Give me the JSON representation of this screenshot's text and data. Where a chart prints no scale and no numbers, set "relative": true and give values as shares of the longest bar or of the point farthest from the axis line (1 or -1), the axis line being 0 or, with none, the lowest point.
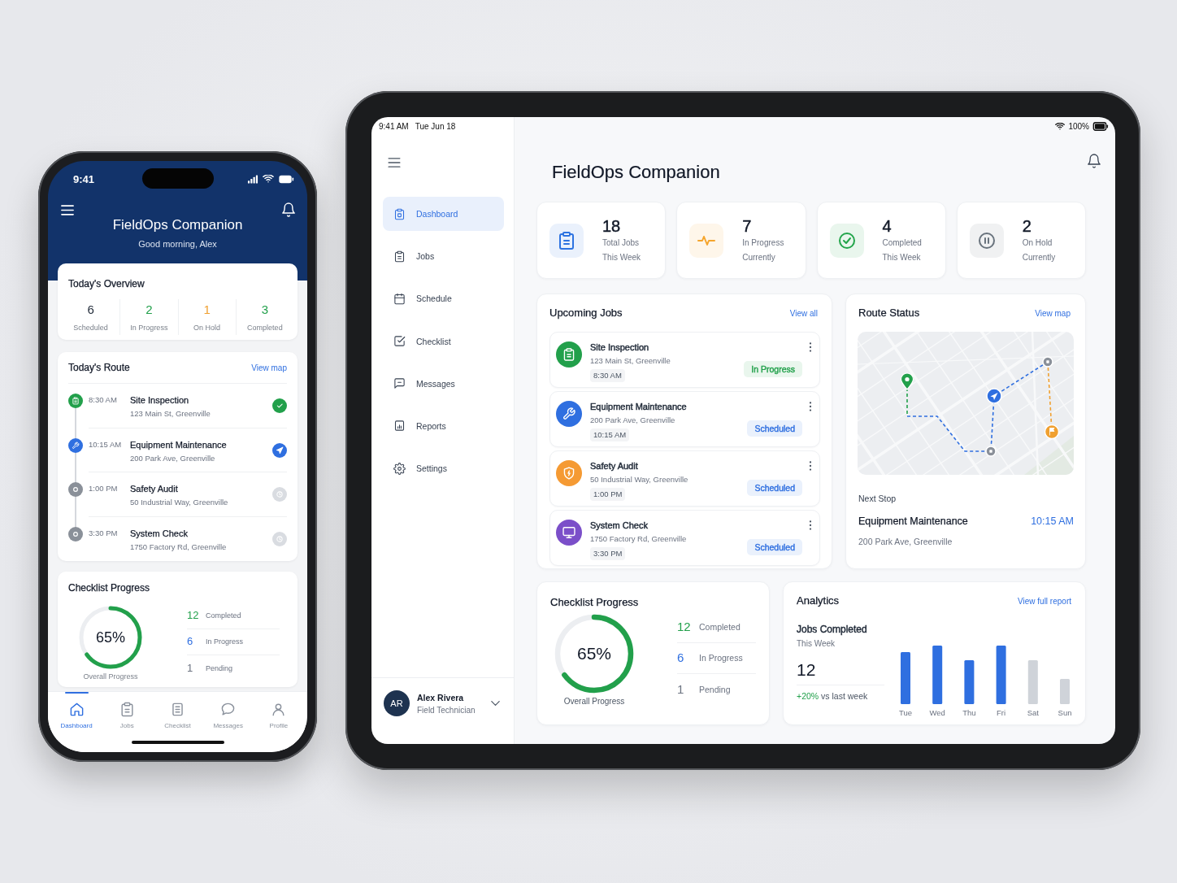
{
  "phone": {
    "status_bar": {
      "time": "9:41"
    },
    "header": {
      "title": "FieldOps Companion",
      "greeting": "Good morning, Alex"
    },
    "overview": {
      "title": "Today's Overview",
      "stats": [
        {
          "value": "6",
          "label": "Scheduled",
          "color": "#1f2937"
        },
        {
          "value": "2",
          "label": "In Progress",
          "color": "#22a04b"
        },
        {
          "value": "1",
          "label": "On Hold",
          "color": "#f0a030"
        },
        {
          "value": "3",
          "label": "Completed",
          "color": "#22a04b"
        }
      ]
    },
    "route": {
      "title": "Today's Route",
      "link": "View map",
      "stops": [
        {
          "time": "8:30 AM",
          "title": "Site Inspection",
          "address": "123 Main St, Greenville",
          "kind": "done"
        },
        {
          "time": "10:15 AM",
          "title": "Equipment Maintenance",
          "address": "200 Park Ave, Greenville",
          "kind": "current"
        },
        {
          "time": "1:00 PM",
          "title": "Safety Audit",
          "address": "50 Industrial Way, Greenville",
          "kind": "upcoming"
        },
        {
          "time": "3:30 PM",
          "title": "System Check",
          "address": "1750 Factory Rd, Greenville",
          "kind": "upcoming"
        }
      ]
    },
    "checklist": {
      "title": "Checklist Progress",
      "level": 0.65,
      "percent": "65%",
      "caption": "Overall Progress",
      "items": [
        {
          "count": "12",
          "label": "Completed",
          "color": "#22a04b"
        },
        {
          "count": "6",
          "label": "In Progress",
          "color": "#2f6fe0"
        },
        {
          "count": "1",
          "label": "Pending",
          "color": "#6b7280"
        }
      ]
    },
    "tab_bar": [
      {
        "label": "Dashboard",
        "selected": true
      },
      {
        "label": "Jobs",
        "selected": false
      },
      {
        "label": "Checklist",
        "selected": false
      },
      {
        "label": "Messages",
        "selected": false
      },
      {
        "label": "Profile",
        "selected": false
      }
    ]
  },
  "tablet": {
    "status_bar": {
      "time": "9:41 AM",
      "date": "Tue Jun 18",
      "battery": "100%"
    },
    "sidebar": {
      "items": [
        {
          "label": "Dashboard",
          "selected": true
        },
        {
          "label": "Jobs",
          "selected": false
        },
        {
          "label": "Schedule",
          "selected": false
        },
        {
          "label": "Checklist",
          "selected": false
        },
        {
          "label": "Messages",
          "selected": false
        },
        {
          "label": "Reports",
          "selected": false
        },
        {
          "label": "Settings",
          "selected": false
        }
      ],
      "user": {
        "initials": "AR",
        "name": "Alex Rivera",
        "role": "Field Technician"
      }
    },
    "header": {
      "title": "FieldOps Companion"
    },
    "stats": [
      {
        "value": "18",
        "label": "Total Jobs",
        "period": "This Week",
        "color": "#eaf1fc"
      },
      {
        "value": "7",
        "label": "In Progress",
        "period": "Currently",
        "color": "#fef6ea"
      },
      {
        "value": "4",
        "label": "Completed",
        "period": "This Week",
        "color": "#e9f6ed"
      },
      {
        "value": "2",
        "label": "On Hold",
        "period": "Currently",
        "color": "#f0f1f2"
      }
    ],
    "upcoming_jobs": {
      "title": "Upcoming Jobs",
      "link": "View all",
      "jobs": [
        {
          "title": "Site Inspection",
          "address": "123 Main St, Greenville",
          "time": "8:30 AM",
          "color": "#22a04b",
          "badge": {
            "label": "In Progress",
            "color": "#22a04b"
          }
        },
        {
          "title": "Equipment Maintenance",
          "address": "200 Park Ave, Greenville",
          "time": "10:15 AM",
          "color": "#2f6fe0",
          "badge": {
            "label": "Scheduled",
            "color": "#2f6fe0"
          }
        },
        {
          "title": "Safety Audit",
          "address": "50 Industrial Way, Greenville",
          "time": "1:00 PM",
          "color": "#f59a33",
          "badge": {
            "label": "Scheduled",
            "color": "#2f6fe0"
          }
        },
        {
          "title": "System Check",
          "address": "1750 Factory Rd, Greenville",
          "time": "3:30 PM",
          "color": "#7b4fc9",
          "badge": {
            "label": "Scheduled",
            "color": "#2f6fe0"
          }
        }
      ]
    },
    "route_status": {
      "title": "Route Status",
      "link": "View map",
      "next_stop": {
        "label": "Next Stop",
        "title": "Equipment Maintenance",
        "time": "10:15 AM",
        "address": "200 Park Ave, Greenville"
      }
    },
    "checklist": {
      "title": "Checklist Progress",
      "level": 0.65,
      "percent": "65%",
      "caption": "Overall Progress",
      "items": [
        {
          "count": "12",
          "label": "Completed",
          "color": "#22a04b"
        },
        {
          "count": "6",
          "label": "In Progress",
          "color": "#2f6fe0"
        },
        {
          "count": "1",
          "label": "Pending",
          "color": "#6b7280"
        }
      ]
    },
    "analytics": {
      "title": "Analytics",
      "link": "View full report",
      "metric": {
        "title": "Jobs Completed",
        "period": "This Week",
        "value": "12",
        "change": "+20%",
        "comparison": "vs last week"
      },
      "chart_data": {
        "type": "bar",
        "relative": true,
        "categories": [
          "Tue",
          "Wed",
          "Thu",
          "Fri",
          "Sat",
          "Sun"
        ],
        "values": [
          0.89,
          1,
          0.75,
          1,
          0.75,
          0.43
        ],
        "colors": [
          "#2f6fe0",
          "#2f6fe0",
          "#2f6fe0",
          "#2f6fe0",
          "#cfd3d9",
          "#cfd3d9"
        ]
      }
    }
  }
}
